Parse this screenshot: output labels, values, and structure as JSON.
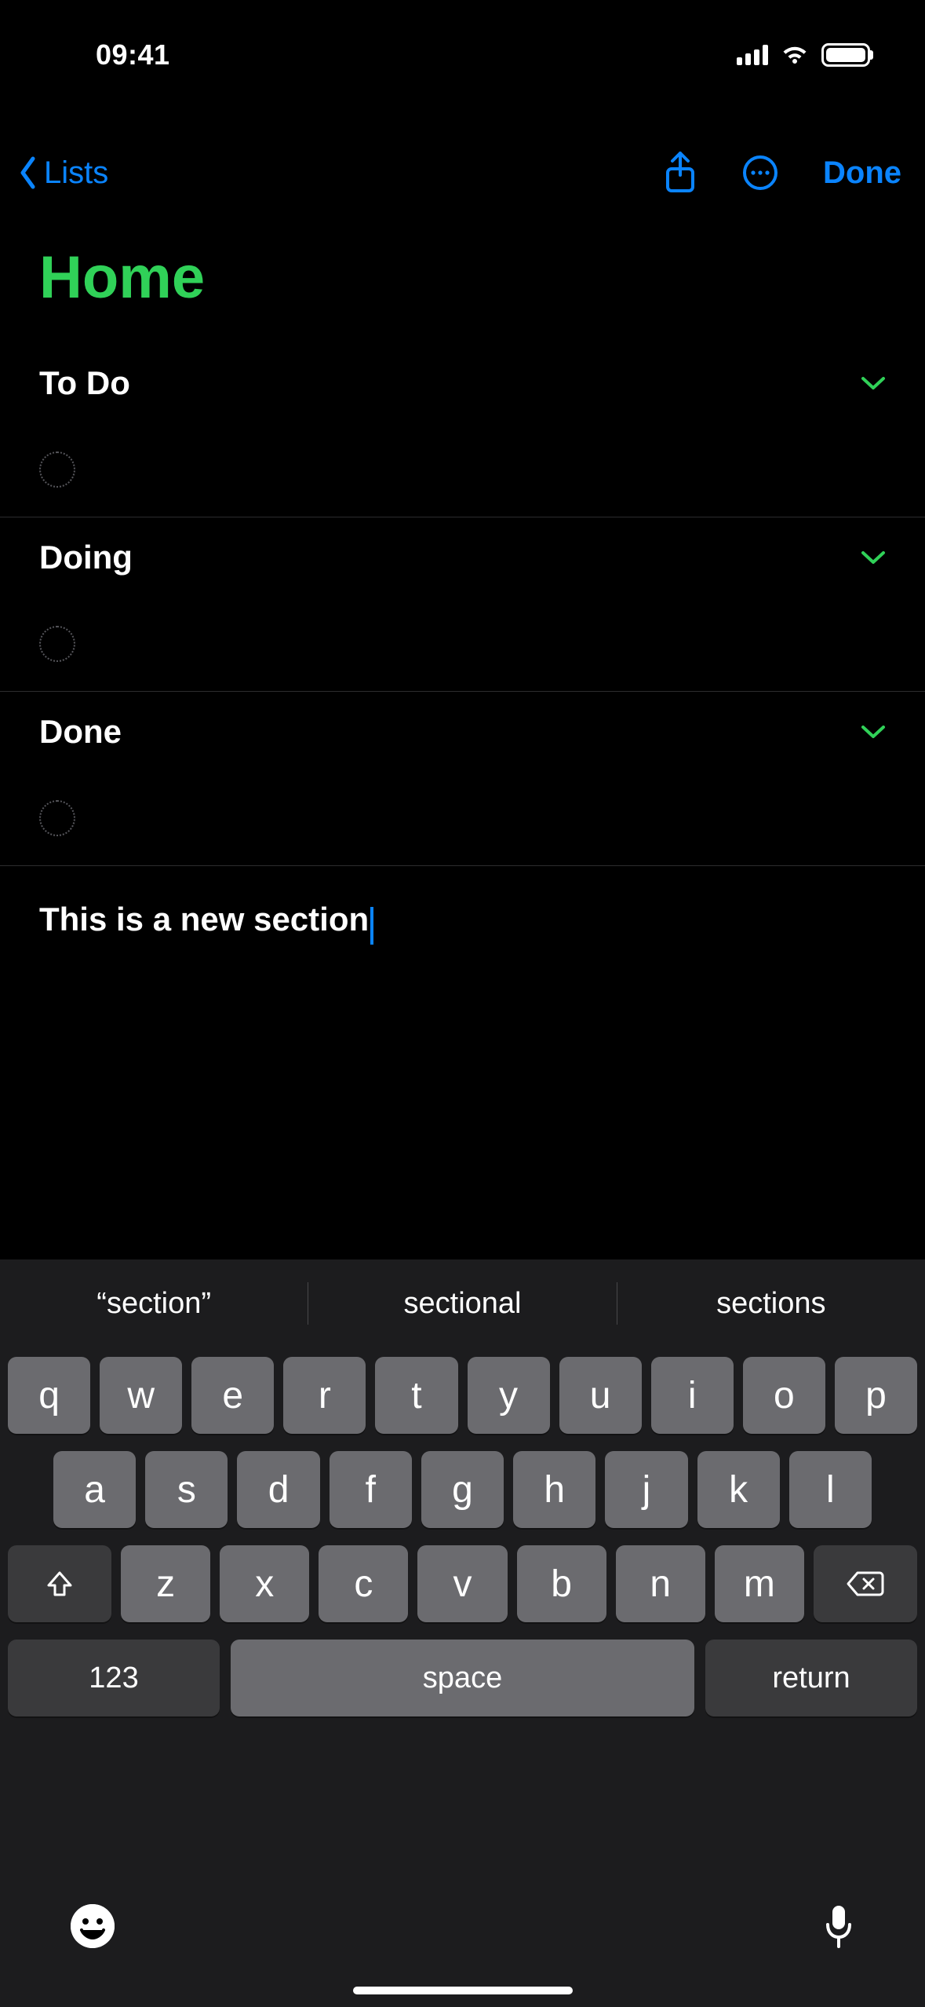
{
  "status": {
    "time": "09:41"
  },
  "nav": {
    "back_label": "Lists",
    "done_label": "Done"
  },
  "list": {
    "title": "Home",
    "sections": [
      {
        "title": "To Do"
      },
      {
        "title": "Doing"
      },
      {
        "title": "Done"
      }
    ],
    "new_section_text": "This is a new section"
  },
  "keyboard": {
    "suggestions": [
      "“section”",
      "sectional",
      "sections"
    ],
    "row1": [
      "q",
      "w",
      "e",
      "r",
      "t",
      "y",
      "u",
      "i",
      "o",
      "p"
    ],
    "row2": [
      "a",
      "s",
      "d",
      "f",
      "g",
      "h",
      "j",
      "k",
      "l"
    ],
    "row3": [
      "z",
      "x",
      "c",
      "v",
      "b",
      "n",
      "m"
    ],
    "num_label": "123",
    "space_label": "space",
    "return_label": "return"
  }
}
